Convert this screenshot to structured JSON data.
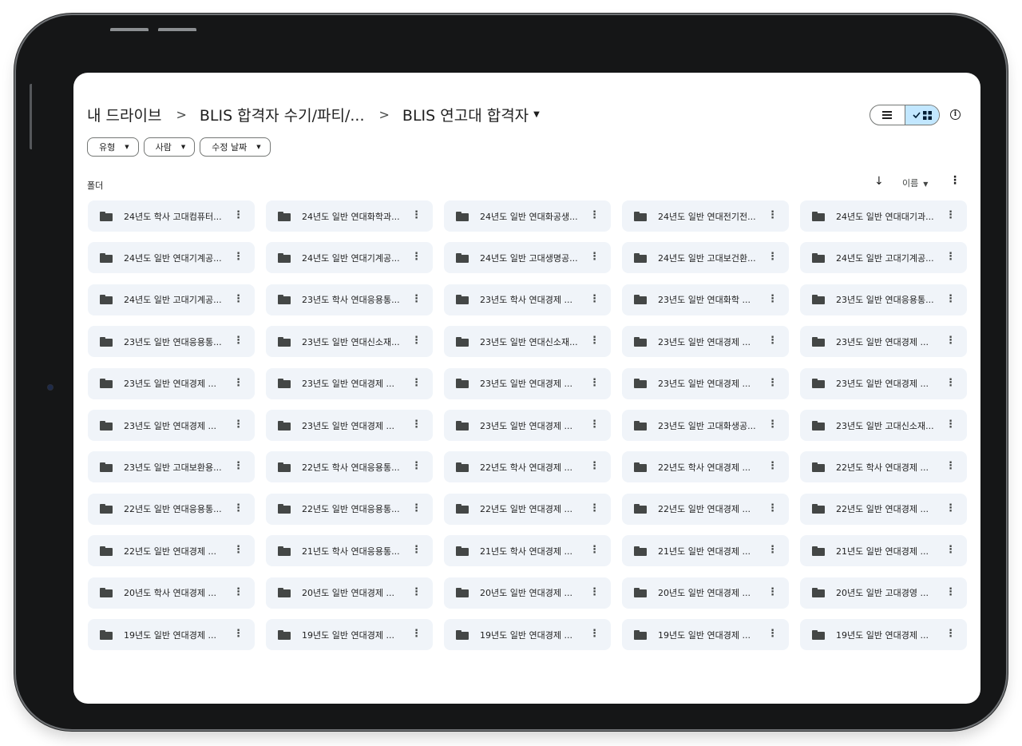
{
  "breadcrumb": {
    "items": [
      "내 드라이브",
      "BLIS 합격자 수기/파티/...",
      "BLIS 연고대 합격자"
    ],
    "separator": ">"
  },
  "view_toggle": {
    "list_icon": "list-icon",
    "grid_icon": "grid-icon",
    "selected": "grid"
  },
  "filters": [
    "유형",
    "사람",
    "수정 날짜"
  ],
  "section": {
    "label": "폴더"
  },
  "sort": {
    "label": "이름"
  },
  "folders": [
    "24년도 학사 고대컴퓨터...",
    "24년도 일반 연대화학과...",
    "24년도 일반 연대화공생...",
    "24년도 일반 연대전기전...",
    "24년도 일반 연대대기과...",
    "24년도 일반 연대기계공...",
    "24년도 일반 연대기계공...",
    "24년도 일반 고대생명공...",
    "24년도 일반 고대보건환...",
    "24년도 일반 고대기계공...",
    "24년도 일반 고대기계공...",
    "23년도 학사 연대응용통...",
    "23년도 학사 연대경제 ...",
    "23년도 일반 연대화학 ...",
    "23년도 일반 연대응용통...",
    "23년도 일반 연대응용통...",
    "23년도 일반 연대신소재...",
    "23년도 일반 연대신소재...",
    "23년도 일반 연대경제 ...",
    "23년도 일반 연대경제 ...",
    "23년도 일반 연대경제 ...",
    "23년도 일반 연대경제 ...",
    "23년도 일반 연대경제 ...",
    "23년도 일반 연대경제 ...",
    "23년도 일반 연대경제 ...",
    "23년도 일반 연대경제 ...",
    "23년도 일반 연대경제 ...",
    "23년도 일반 연대경제 ...",
    "23년도 일반 고대화생공...",
    "23년도 일반 고대신소재...",
    "23년도 일반 고대보환용...",
    "22년도 학사 연대응용통...",
    "22년도 학사 연대경제 ...",
    "22년도 학사 연대경제 ...",
    "22년도 학사 연대경제 ...",
    "22년도 일반 연대응용통...",
    "22년도 일반 연대응용통...",
    "22년도 일반 연대경제 ...",
    "22년도 일반 연대경제 ...",
    "22년도 일반 연대경제 ...",
    "22년도 일반 연대경제 ...",
    "21년도 학사 연대응용통...",
    "21년도 학사 연대경제 ...",
    "21년도 일반 연대경제 ...",
    "21년도 일반 연대경제 ...",
    "20년도 학사 연대경제 ...",
    "20년도 일반 연대경제 ...",
    "20년도 일반 연대경제 ...",
    "20년도 일반 연대경제 ...",
    "20년도 일반 고대경영 ...",
    "19년도 일반 연대경제 ...",
    "19년도 일반 연대경제 ...",
    "19년도 일반 연대경제 ...",
    "19년도 일반 연대경제 ...",
    "19년도 일반 연대경제 ..."
  ],
  "icons": {
    "folder": "folder-icon",
    "more": "more-vert-icon",
    "sort_direction": "arrow-down-icon",
    "info": "info-icon"
  },
  "colors": {
    "tile_bg": "#f0f4f9",
    "toggle_selected": "#c2e7ff",
    "bezel": "#151617"
  }
}
